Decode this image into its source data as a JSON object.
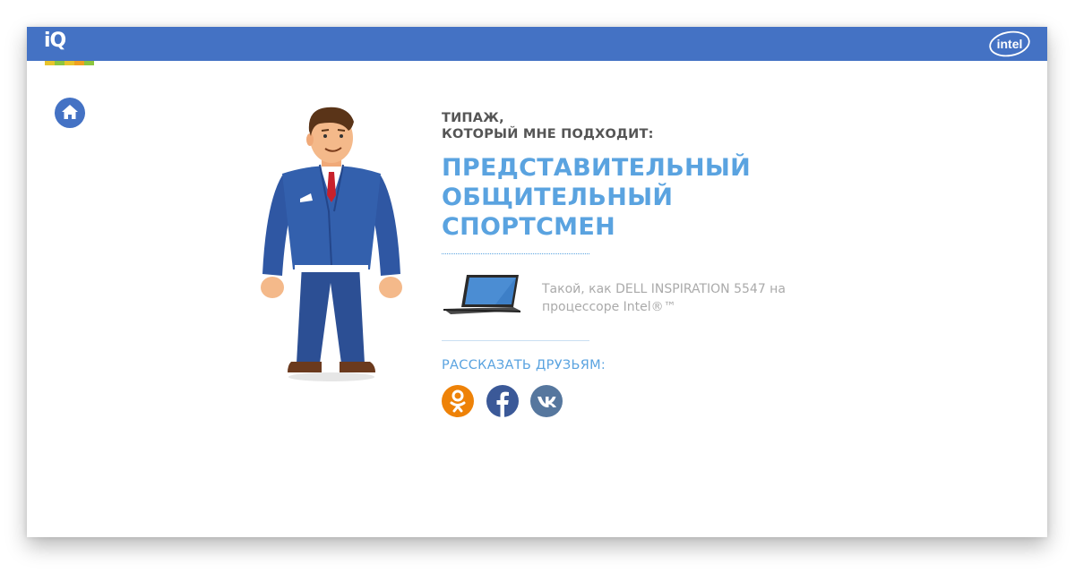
{
  "header": {
    "logo_text": "iQ",
    "intel_logo_text": "intel"
  },
  "result": {
    "subtitle_lines": [
      "ТИПАЖ,",
      "КОТОРЫЙ МНЕ ПОДХОДИТ:"
    ],
    "type_lines": [
      "ПРЕДСТАВИТЕЛЬНЫЙ",
      "ОБЩИТЕЛЬНЫЙ",
      "СПОРТСМЕН"
    ],
    "product_text": "Такой, как DELL INSPIRATION 5547 на процессоре Intel®™",
    "share_label": "РАССКАЗАТЬ ДРУЗЬЯМ:"
  },
  "icons": {
    "home": "home-icon",
    "laptop": "laptop-image",
    "character": "businessman-illustration",
    "social": [
      "odnoklassniki-icon",
      "facebook-icon",
      "vk-icon"
    ]
  },
  "colors": {
    "brand_blue": "#4472c4",
    "accent_blue": "#5aa3e0",
    "odnoklassniki": "#ee8208",
    "facebook": "#3b5998",
    "vk": "#56779e"
  }
}
